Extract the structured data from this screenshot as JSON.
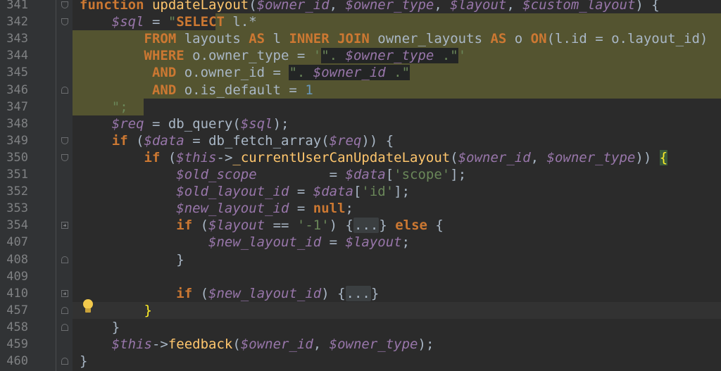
{
  "editor": {
    "lines": [
      {
        "no": "341",
        "code": [
          [
            "kw",
            "function "
          ],
          [
            "fn",
            "updateLayout"
          ],
          [
            "p",
            "("
          ],
          [
            "var",
            "$owner_id"
          ],
          [
            "p",
            ", "
          ],
          [
            "var",
            "$owner_type"
          ],
          [
            "p",
            ", "
          ],
          [
            "var",
            "$layout"
          ],
          [
            "p",
            ", "
          ],
          [
            "var",
            "$custom_layout"
          ],
          [
            "p",
            ") {"
          ]
        ]
      },
      {
        "no": "342",
        "code": [
          [
            "p",
            "    "
          ],
          [
            "var",
            "$sql"
          ],
          [
            "p",
            " = "
          ],
          [
            "str",
            "\""
          ],
          [
            "kw",
            "SELECT "
          ],
          [
            "p",
            "l.*"
          ]
        ]
      },
      {
        "no": "343",
        "code": [
          [
            "p",
            "        "
          ],
          [
            "kw",
            "FROM "
          ],
          [
            "p",
            "layouts "
          ],
          [
            "kw",
            "AS "
          ],
          [
            "p",
            "l "
          ],
          [
            "kw",
            "INNER JOIN "
          ],
          [
            "p",
            "owner_layouts "
          ],
          [
            "kw",
            "AS "
          ],
          [
            "p",
            "o "
          ],
          [
            "kw",
            "ON"
          ],
          [
            "p",
            "(l.id = o.layout_id)"
          ]
        ]
      },
      {
        "no": "344",
        "code": [
          [
            "p",
            "        "
          ],
          [
            "kw",
            "WHERE "
          ],
          [
            "p",
            "o.owner_type = "
          ],
          [
            "str",
            "'"
          ],
          [
            "sqld",
            "\". "
          ],
          [
            "varsd",
            "$owner_type"
          ],
          [
            "sqld",
            " .\""
          ],
          [
            "str",
            "'"
          ]
        ]
      },
      {
        "no": "345",
        "code": [
          [
            "p",
            "         "
          ],
          [
            "kw",
            "AND "
          ],
          [
            "p",
            "o.owner_id = "
          ],
          [
            "sqld",
            "\". "
          ],
          [
            "varsd",
            "$owner_id"
          ],
          [
            "sqld",
            " .\""
          ]
        ]
      },
      {
        "no": "346",
        "code": [
          [
            "p",
            "         "
          ],
          [
            "kw",
            "AND "
          ],
          [
            "p",
            "o.is_default = "
          ],
          [
            "num",
            "1"
          ]
        ]
      },
      {
        "no": "347",
        "code": [
          [
            "p",
            "    "
          ],
          [
            "str",
            "\";"
          ]
        ]
      },
      {
        "no": "348",
        "code": [
          [
            "p",
            "    "
          ],
          [
            "var",
            "$req"
          ],
          [
            "p",
            " = db_query("
          ],
          [
            "var",
            "$sql"
          ],
          [
            "p",
            ");"
          ]
        ]
      },
      {
        "no": "349",
        "code": [
          [
            "p",
            "    "
          ],
          [
            "kw",
            "if "
          ],
          [
            "p",
            "("
          ],
          [
            "var",
            "$data"
          ],
          [
            "p",
            " = db_fetch_array("
          ],
          [
            "var",
            "$req"
          ],
          [
            "p",
            ")) {"
          ]
        ]
      },
      {
        "no": "350",
        "code": [
          [
            "p",
            "        "
          ],
          [
            "kw",
            "if "
          ],
          [
            "p",
            "("
          ],
          [
            "var",
            "$this"
          ],
          [
            "p",
            "->"
          ],
          [
            "fn",
            "_currentUserCanUpdateLayout"
          ],
          [
            "p",
            "("
          ],
          [
            "var",
            "$owner_id"
          ],
          [
            "p",
            ", "
          ],
          [
            "var",
            "$owner_type"
          ],
          [
            "p",
            ")) "
          ],
          [
            "bm",
            "{"
          ]
        ]
      },
      {
        "no": "351",
        "code": [
          [
            "p",
            "            "
          ],
          [
            "var",
            "$old_scope"
          ],
          [
            "p",
            "         = "
          ],
          [
            "var",
            "$data"
          ],
          [
            "p",
            "["
          ],
          [
            "str",
            "'scope'"
          ],
          [
            "p",
            "];"
          ]
        ]
      },
      {
        "no": "352",
        "code": [
          [
            "p",
            "            "
          ],
          [
            "var",
            "$old_layout_id"
          ],
          [
            "p",
            " = "
          ],
          [
            "var",
            "$data"
          ],
          [
            "p",
            "["
          ],
          [
            "str",
            "'id'"
          ],
          [
            "p",
            "];"
          ]
        ]
      },
      {
        "no": "353",
        "code": [
          [
            "p",
            "            "
          ],
          [
            "var",
            "$new_layout_id"
          ],
          [
            "p",
            " = "
          ],
          [
            "kw",
            "null"
          ],
          [
            "p",
            ";"
          ]
        ]
      },
      {
        "no": "354",
        "code": [
          [
            "p",
            "            "
          ],
          [
            "kw",
            "if "
          ],
          [
            "p",
            "("
          ],
          [
            "var",
            "$layout"
          ],
          [
            "p",
            " == "
          ],
          [
            "str",
            "'-1'"
          ],
          [
            "p",
            ") {"
          ],
          [
            "ph",
            "..."
          ],
          [
            "p",
            "} "
          ],
          [
            "kw",
            "else "
          ],
          [
            "p",
            "{"
          ]
        ]
      },
      {
        "no": "407",
        "code": [
          [
            "p",
            "                "
          ],
          [
            "var",
            "$new_layout_id"
          ],
          [
            "p",
            " = "
          ],
          [
            "var",
            "$layout"
          ],
          [
            "p",
            ";"
          ]
        ]
      },
      {
        "no": "408",
        "code": [
          [
            "p",
            "            }"
          ]
        ]
      },
      {
        "no": "409",
        "code": [
          [
            "p",
            ""
          ]
        ]
      },
      {
        "no": "410",
        "code": [
          [
            "p",
            "            "
          ],
          [
            "kw",
            "if "
          ],
          [
            "p",
            "("
          ],
          [
            "var",
            "$new_layout_id"
          ],
          [
            "p",
            ") {"
          ],
          [
            "ph",
            "..."
          ],
          [
            "p",
            "}"
          ]
        ]
      },
      {
        "no": "457",
        "code": [
          [
            "p",
            "        "
          ],
          [
            "bm2",
            "}"
          ]
        ]
      },
      {
        "no": "458",
        "code": [
          [
            "p",
            "    }"
          ]
        ]
      },
      {
        "no": "459",
        "code": [
          [
            "p",
            "    "
          ],
          [
            "var",
            "$this"
          ],
          [
            "p",
            "->"
          ],
          [
            "fn",
            "feedback"
          ],
          [
            "p",
            "("
          ],
          [
            "var",
            "$owner_id"
          ],
          [
            "p",
            ", "
          ],
          [
            "var",
            "$owner_type"
          ],
          [
            "p",
            ");"
          ]
        ]
      },
      {
        "no": "460",
        "code": [
          [
            "p",
            "}"
          ]
        ]
      }
    ],
    "folds": [
      {
        "line": "341",
        "kind": "open"
      },
      {
        "line": "342",
        "kind": "open"
      },
      {
        "line": "346",
        "kind": "close"
      },
      {
        "line": "349",
        "kind": "open"
      },
      {
        "line": "350",
        "kind": "open"
      },
      {
        "line": "354",
        "kind": "plus"
      },
      {
        "line": "408",
        "kind": "close"
      },
      {
        "line": "410",
        "kind": "plus"
      },
      {
        "line": "457",
        "kind": "close"
      },
      {
        "line": "458",
        "kind": "close"
      },
      {
        "line": "460",
        "kind": "close"
      }
    ],
    "intention_icon": "lightbulb-icon",
    "current_line": "457"
  },
  "colors": {
    "background": "#2b2b2b",
    "gutter": "#313335",
    "keyword": "#cc7832",
    "variable": "#9876aa",
    "function": "#ffc66d",
    "string": "#6a8759",
    "number": "#6897bb",
    "sql_highlight": "#545430"
  }
}
